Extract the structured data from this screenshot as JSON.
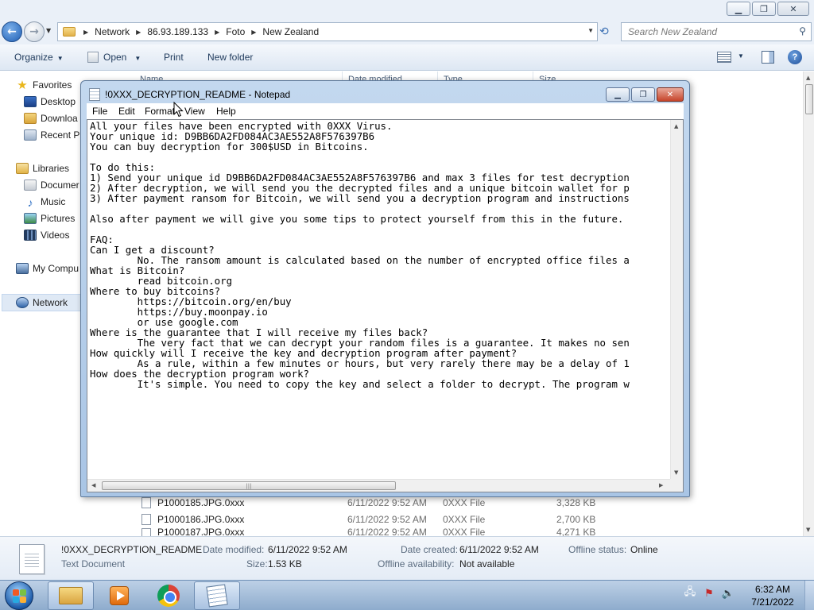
{
  "explorer": {
    "address": {
      "crumbs": [
        "Network",
        "86.93.189.133",
        "Foto",
        "New Zealand"
      ]
    },
    "search": {
      "placeholder": "Search New Zealand"
    },
    "toolbar": {
      "organize": "Organize",
      "open": "Open",
      "print": "Print",
      "new_folder": "New folder"
    },
    "columns": {
      "name": "Name",
      "date": "Date modified",
      "type": "Type",
      "size": "Size"
    },
    "nav": {
      "favorites": "Favorites",
      "desktop": "Desktop",
      "downloads": "Downloa",
      "recent": "Recent Pl",
      "libraries": "Libraries",
      "documents": "Documer",
      "music": "Music",
      "pictures": "Pictures",
      "videos": "Videos",
      "computer": "My Compu",
      "network": "Network"
    },
    "files": [
      {
        "name": "P1000185.JPG.0xxx",
        "date": "6/11/2022 9:52 AM",
        "type": "0XXX File",
        "size": "3,328 KB"
      },
      {
        "name": "P1000186.JPG.0xxx",
        "date": "6/11/2022 9:52 AM",
        "type": "0XXX File",
        "size": "2,700 KB"
      },
      {
        "name": "P1000187.JPG.0xxx",
        "date": "6/11/2022 9:52 AM",
        "type": "0XXX File",
        "size": "4,271 KB"
      }
    ],
    "details": {
      "filename": "!0XXX_DECRYPTION_README",
      "filetype": "Text Document",
      "date_modified_label": "Date modified:",
      "date_modified": "6/11/2022 9:52 AM",
      "size_label": "Size:",
      "size": "1.53 KB",
      "date_created_label": "Date created:",
      "date_created": "6/11/2022 9:52 AM",
      "availability_label": "Offline availability:",
      "availability": "Not available",
      "offline_label": "Offline status:",
      "offline": "Online"
    }
  },
  "notepad": {
    "title": "!0XXX_DECRYPTION_README - Notepad",
    "menu": [
      "File",
      "Edit",
      "Format",
      "View",
      "Help"
    ],
    "lines": [
      "All your files have been encrypted with 0XXX Virus.",
      "Your unique id: D9BB6DA2FD084AC3AE552A8F576397B6",
      "You can buy decryption for 300$USD in Bitcoins.",
      "",
      "To do this:",
      "1) Send your unique id D9BB6DA2FD084AC3AE552A8F576397B6 and max 3 files for test decryption",
      "2) After decryption, we will send you the decrypted files and a unique bitcoin wallet for p",
      "3) After payment ransom for Bitcoin, we will send you a decryption program and instructions",
      "",
      "Also after payment we will give you some tips to protect yourself from this in the future.",
      "",
      "FAQ:",
      "Can I get a discount?",
      "        No. The ransom amount is calculated based on the number of encrypted office files a",
      "What is Bitcoin?",
      "        read bitcoin.org",
      "Where to buy bitcoins?",
      "        https://bitcoin.org/en/buy",
      "        https://buy.moonpay.io",
      "        or use google.com",
      "Where is the guarantee that I will receive my files back?",
      "        The very fact that we can decrypt your random files is a guarantee. It makes no sen",
      "How quickly will I receive the key and decryption program after payment?",
      "        As a rule, within a few minutes or hours, but very rarely there may be a delay of 1",
      "How does the decryption program work?",
      "        It's simple. You need to copy the key and select a folder to decrypt. The program w"
    ]
  },
  "taskbar": {
    "time": "6:32 AM",
    "date": "7/21/2022"
  }
}
